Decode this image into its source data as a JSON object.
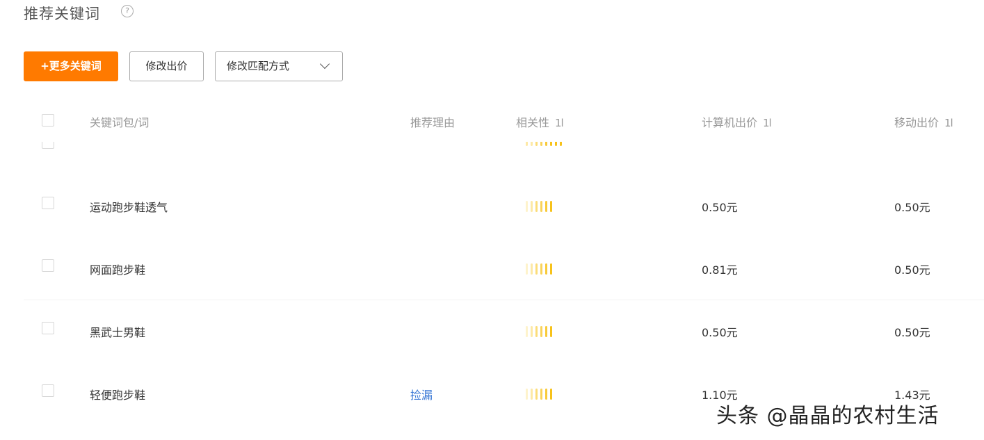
{
  "section": {
    "title": "推荐关键词",
    "help_icon": "question-circle-icon"
  },
  "toolbar": {
    "add_more_label": "+更多关键词",
    "edit_bid_label": "修改出价",
    "edit_match_label": "修改匹配方式"
  },
  "table": {
    "columns": {
      "keyword": "关键词包/词",
      "reason": "推荐理由",
      "relevance": "相关性",
      "pc_bid": "计算机出价",
      "mobile_bid": "移动出价"
    },
    "sort_icon": "1l",
    "rows": [
      {
        "keyword": "运动跑步鞋透气",
        "reason": "",
        "relevance_level": 6,
        "pc_bid": "0.50元",
        "mobile_bid": "0.50元"
      },
      {
        "keyword": "网面跑步鞋",
        "reason": "",
        "relevance_level": 6,
        "pc_bid": "0.81元",
        "mobile_bid": "0.50元"
      },
      {
        "keyword": "黑武士男鞋",
        "reason": "",
        "relevance_level": 6,
        "pc_bid": "0.50元",
        "mobile_bid": "0.50元"
      },
      {
        "keyword": "轻便跑步鞋",
        "reason": "捡漏",
        "relevance_level": 6,
        "pc_bid": "1.10元",
        "mobile_bid": "1.43元"
      }
    ]
  },
  "colors": {
    "primary": "#ff7a00",
    "link": "#3a78d6",
    "relevance_bar_light": "#fde9a6",
    "relevance_bar_strong": "#f7c21a"
  },
  "watermark": "头条 @晶晶的农村生活"
}
